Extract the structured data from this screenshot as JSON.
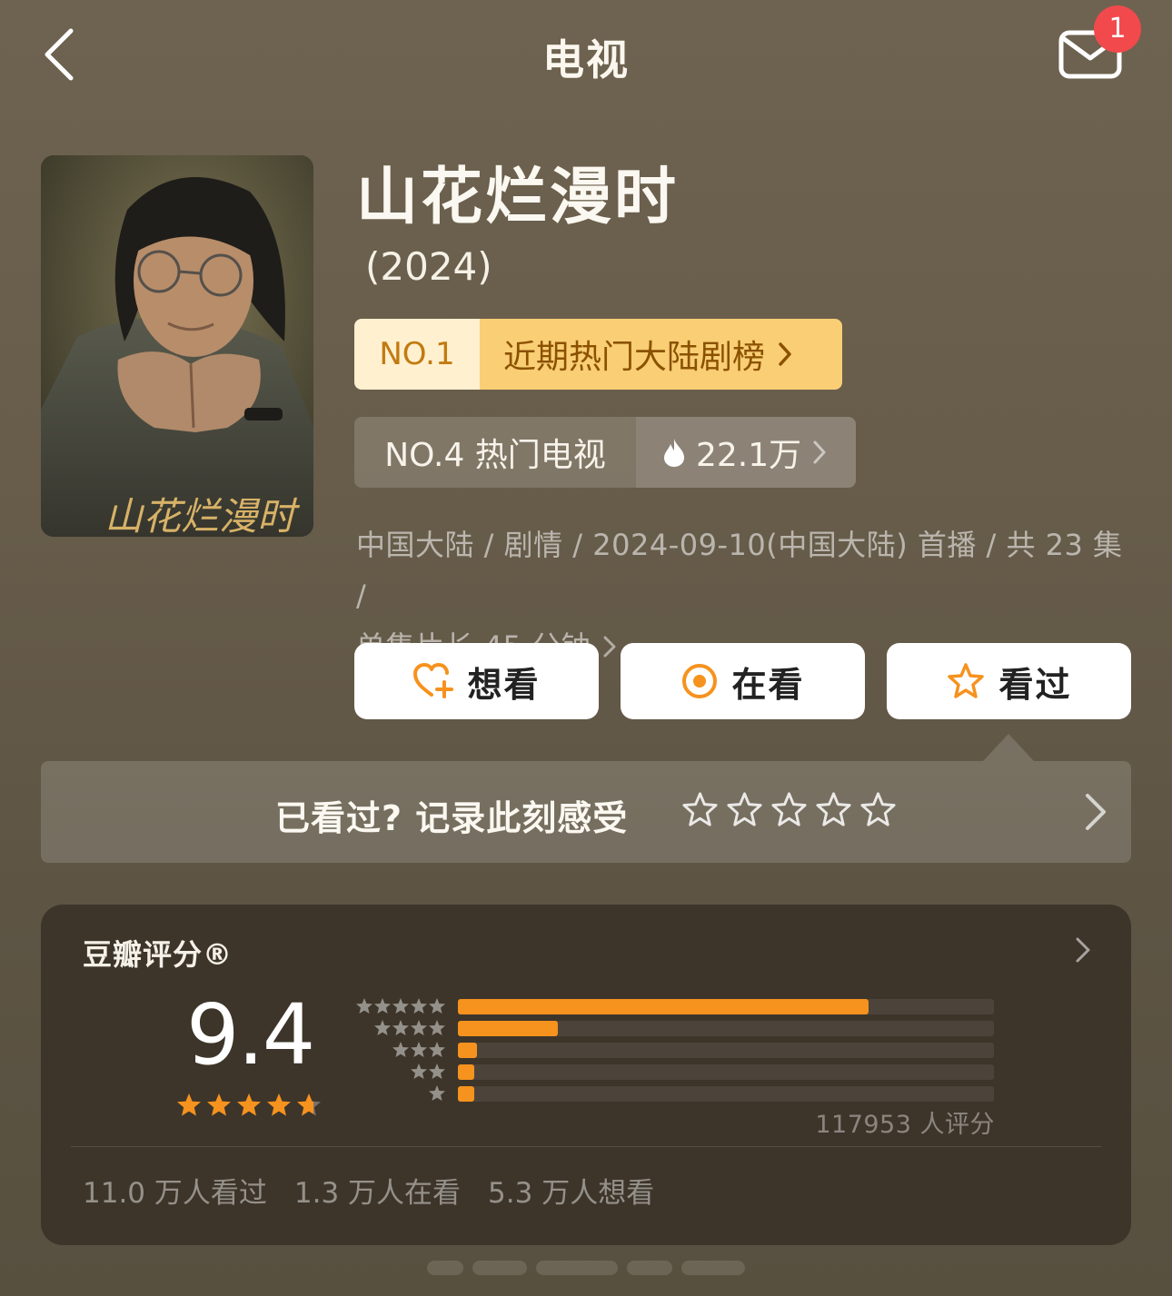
{
  "header": {
    "title": "电视",
    "notification_count": "1"
  },
  "subject": {
    "title": "山花烂漫时",
    "year": "(2024)",
    "poster_caption": "山花烂漫时"
  },
  "ranks": {
    "primary": {
      "number": "NO.1",
      "label": "近期热门大陆剧榜"
    },
    "secondary": {
      "number": "NO.4 热门电视",
      "heat": "22.1万"
    }
  },
  "meta": {
    "line1": "中国大陆 / 剧情 / 2024-09-10(中国大陆) 首播 / 共 23 集 /",
    "line2": "单集片长 45 分钟"
  },
  "actions": {
    "wish": "想看",
    "doing": "在看",
    "done": "看过"
  },
  "record": {
    "prompt": "已看过?  记录此刻感受",
    "star_count": 5
  },
  "rating": {
    "title": "豆瓣评分®",
    "score": "9.4",
    "score_stars": 4.7,
    "distribution_percent": [
      76.6,
      18.7,
      3.6,
      0.6,
      0.5
    ],
    "count_text": "117953 人评分",
    "stats": {
      "watched": "11.0 万人看过",
      "watching": "1.3 万人在看",
      "wish": "5.3 万人想看"
    }
  },
  "colors": {
    "accent_orange": "#f6921e",
    "rank_gold": "#f9ce74",
    "badge_red": "#f2494d"
  },
  "icons": [
    "chevron-left-icon",
    "mail-icon",
    "fire-icon",
    "heart-plus-icon",
    "target-icon",
    "star-icon",
    "chevron-right-icon"
  ]
}
